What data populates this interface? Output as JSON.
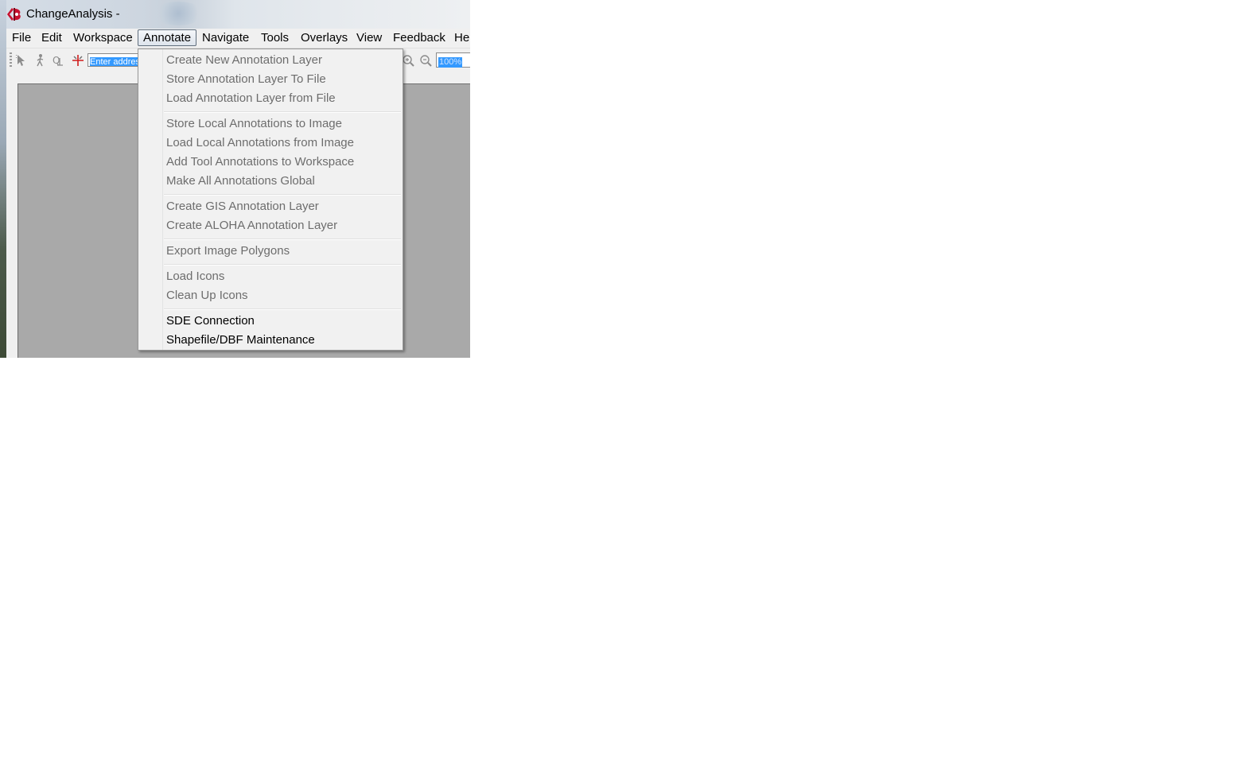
{
  "window": {
    "title": "ChangeAnalysis -"
  },
  "menubar": {
    "items": [
      {
        "label": "File"
      },
      {
        "label": "Edit"
      },
      {
        "label": "Workspace"
      },
      {
        "label": "Annotate"
      },
      {
        "label": "Navigate"
      },
      {
        "label": "Tools"
      },
      {
        "label": "Overlays"
      },
      {
        "label": "View"
      },
      {
        "label": "Feedback"
      },
      {
        "label": "He"
      }
    ],
    "active": "Annotate"
  },
  "toolbar": {
    "address_placeholder": "Enter address",
    "zoom_value": "100%",
    "icons": [
      "select-arrow-icon",
      "walk-icon",
      "query-icon",
      "crosshair-icon",
      "zoom-in-icon",
      "zoom-out-icon"
    ]
  },
  "annotate_menu": {
    "groups": [
      [
        {
          "label": "Create New Annotation Layer",
          "enabled": false
        },
        {
          "label": "Store Annotation Layer To File",
          "enabled": false
        },
        {
          "label": "Load Annotation Layer from File",
          "enabled": false
        }
      ],
      [
        {
          "label": "Store Local Annotations to Image",
          "enabled": false
        },
        {
          "label": "Load Local Annotations from Image",
          "enabled": false
        },
        {
          "label": "Add Tool Annotations to Workspace",
          "enabled": false
        },
        {
          "label": "Make All Annotations Global",
          "enabled": false
        }
      ],
      [
        {
          "label": "Create GIS Annotation Layer",
          "enabled": false
        },
        {
          "label": "Create ALOHA Annotation Layer",
          "enabled": false
        }
      ],
      [
        {
          "label": "Export Image Polygons",
          "enabled": false
        }
      ],
      [
        {
          "label": "Load Icons",
          "enabled": false
        },
        {
          "label": "Clean Up Icons",
          "enabled": false
        }
      ],
      [
        {
          "label": "SDE Connection",
          "enabled": true
        },
        {
          "label": "Shapefile/DBF Maintenance",
          "enabled": true
        }
      ]
    ]
  },
  "colors": {
    "disabled_text": "#6d6d6d",
    "selection_blue": "#3399ff",
    "canvas_gray": "#a9a9a9"
  }
}
